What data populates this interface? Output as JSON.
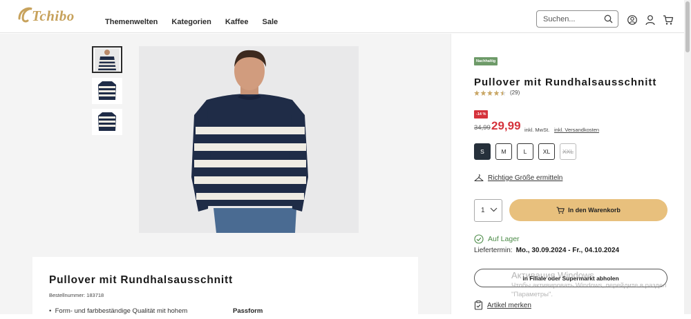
{
  "header": {
    "logo": "Tchibo",
    "nav": [
      "Themenwelten",
      "Kategorien",
      "Kaffee",
      "Sale"
    ],
    "search_placeholder": "Suchen..."
  },
  "product": {
    "badge": "Nachhaltig",
    "title": "Pullover mit Rundhalsausschnitt",
    "rating": 4.5,
    "rating_count": "(29)",
    "discount": "-14 %",
    "old_price": "34,99",
    "price": "29,99",
    "vat": "inkl. MwSt.",
    "shipping": "inkl. Versandkosten",
    "sizes": [
      {
        "label": "S",
        "state": "selected"
      },
      {
        "label": "M",
        "state": "available"
      },
      {
        "label": "L",
        "state": "available"
      },
      {
        "label": "XL",
        "state": "available"
      },
      {
        "label": "XXL",
        "state": "unavailable"
      }
    ],
    "size_finder": "Richtige Größe ermitteln",
    "quantity": "1",
    "add_to_cart": "In den Warenkorb",
    "stock": "Auf Lager",
    "delivery_label": "Liefertermin:",
    "delivery_dates": "Mo., 30.09.2024 - Fr., 04.10.2024",
    "pickup": "In Filiale oder Supermarkt abholen",
    "remember": "Artikel merken",
    "accent_color": "#e8c07d",
    "sale_color": "#d5323b",
    "stock_color": "#4a8a46"
  },
  "description": {
    "title": "Pullover mit Rundhalsausschnitt",
    "order_number": "Bestellnummer: 183718",
    "bullet": "Form- und farbbeständige Qualität mit hohem",
    "fit_label": "Passform"
  },
  "watermark": {
    "title": "Активация Windows",
    "line1": "Чтобы активировать Windows, перейдите в раздел",
    "line2": "\"Параметры\"."
  }
}
